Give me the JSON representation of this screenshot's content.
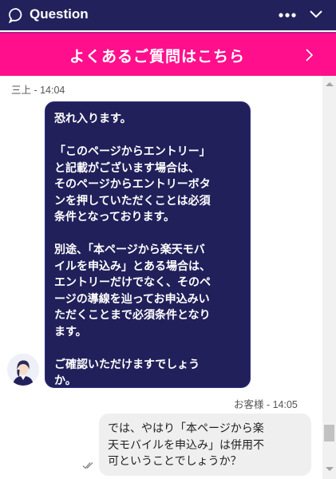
{
  "header": {
    "title": "Question",
    "icons": [
      "chat-bubble-icon",
      "more-icon",
      "chevron-down-icon"
    ],
    "background": "#23215c"
  },
  "faq_banner": {
    "label": "よくあるご質問はこちら",
    "background": "#ff0f8c",
    "icon": "chevron-right-icon"
  },
  "messages": [
    {
      "sender_line": "三上 - 14:04",
      "text": "恐れ入ります。\n\n「このページからエントリー」\nと記載がございます場合は、\nそのページからエントリーボタ\nンを押していただくことは必須\n条件となっております。\n\n別途、「本ページから楽天モバ\nイルを申込み」とある場合は、\nエントリーだけでなく、そのペ\nージの導線を辿ってお申込みい\nただくことまで必須条件となり\nます。\n\nご確認いただけますでしょう\nか。",
      "bubble_color": "#21205a"
    },
    {
      "sender_line": "お客様 - 14:05",
      "text": "では、やはり「本ページから楽\n天モバイルを申込み」は併用不\n可ということでしょうか？",
      "bubble_color": "#efefef",
      "status_icon": "read-check-icon"
    }
  ]
}
